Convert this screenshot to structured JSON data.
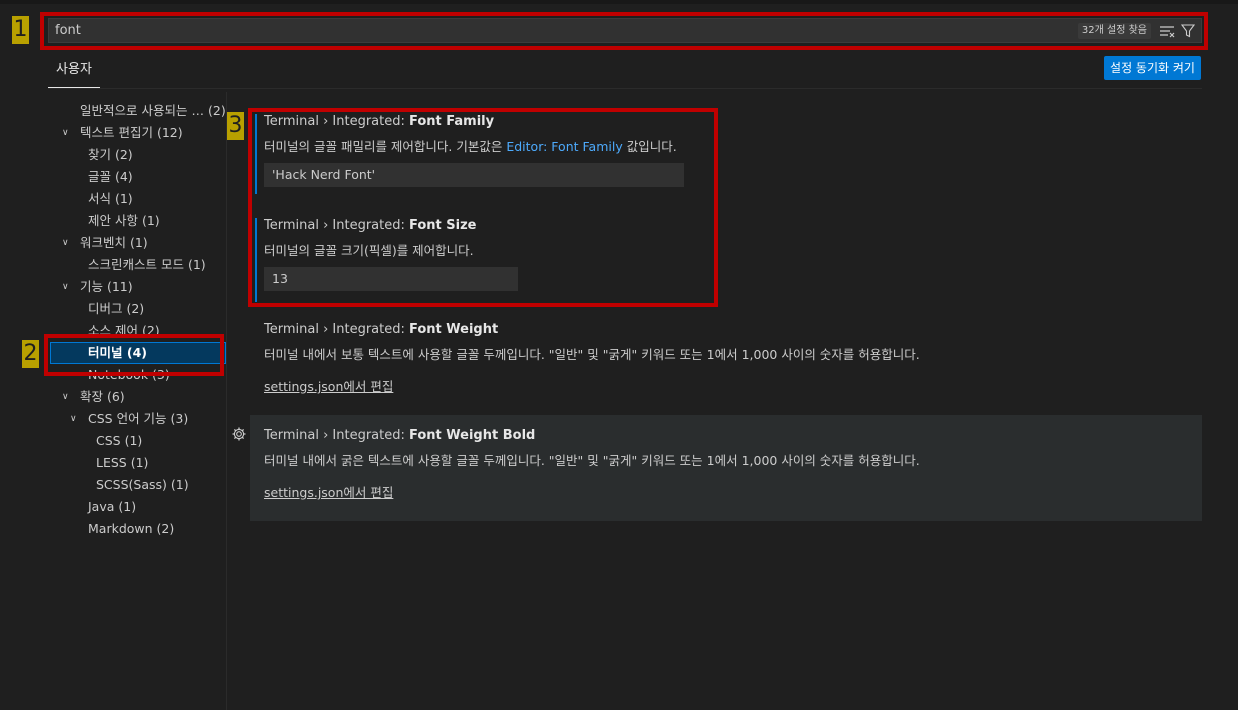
{
  "search": {
    "value": "font",
    "result_count": "32개 설정 찾음",
    "icons": [
      "clear-filter-icon",
      "filter-icon"
    ]
  },
  "scope_tab": "사용자",
  "sync_button": "설정 동기화 켜기",
  "toc": [
    {
      "label": "일반적으로 사용되는 …",
      "count": "(2)"
    },
    {
      "label": "텍스트 편집기 (12)"
    },
    {
      "label": "찾기 (2)"
    },
    {
      "label": "글꼴 (4)"
    },
    {
      "label": "서식 (1)"
    },
    {
      "label": "제안 사항 (1)"
    },
    {
      "label": "워크벤치 (1)"
    },
    {
      "label": "스크린캐스트 모드 (1)"
    },
    {
      "label": "기능 (11)"
    },
    {
      "label": "디버그 (2)"
    },
    {
      "label": "소스 제어 (2)"
    },
    {
      "label": "터미널 (4)"
    },
    {
      "label": "Notebook (3)"
    },
    {
      "label": "확장 (6)"
    },
    {
      "label": "CSS 언어 기능 (3)"
    },
    {
      "label": "CSS (1)"
    },
    {
      "label": "LESS (1)"
    },
    {
      "label": "SCSS(Sass) (1)"
    },
    {
      "label": "Java (1)"
    },
    {
      "label": "Markdown (2)"
    }
  ],
  "settings": [
    {
      "prefix": "Terminal › Integrated: ",
      "name": "Font Family",
      "desc_before": "터미널의 글꼴 패밀리를 제어합니다. 기본값은 ",
      "desc_link": "Editor: Font Family",
      "desc_after": " 값입니다.",
      "value": "'Hack Nerd Font'"
    },
    {
      "prefix": "Terminal › Integrated: ",
      "name": "Font Size",
      "desc": "터미널의 글꼴 크기(픽셀)를 제어합니다.",
      "value": "13"
    },
    {
      "prefix": "Terminal › Integrated: ",
      "name": "Font Weight",
      "desc": "터미널 내에서 보통 텍스트에 사용할 글꼴 두께입니다. \"일반\" 및 \"굵게\" 키워드 또는 1에서 1,000 사이의 숫자를 허용합니다.",
      "link": "settings.json에서 편집"
    },
    {
      "prefix": "Terminal › Integrated: ",
      "name": "Font Weight Bold",
      "desc": "터미널 내에서 굵은 텍스트에 사용할 글꼴 두께입니다. \"일반\" 및 \"굵게\" 키워드 또는 1에서 1,000 사이의 숫자를 허용합니다.",
      "link": "settings.json에서 편집"
    }
  ],
  "annotations": [
    "1",
    "2",
    "3"
  ],
  "colors": {
    "background": "#1f1f1f",
    "accent": "#0078d4",
    "link": "#4daafc",
    "annotation_box": "#c00000",
    "annotation_badge": "#b8a000"
  }
}
